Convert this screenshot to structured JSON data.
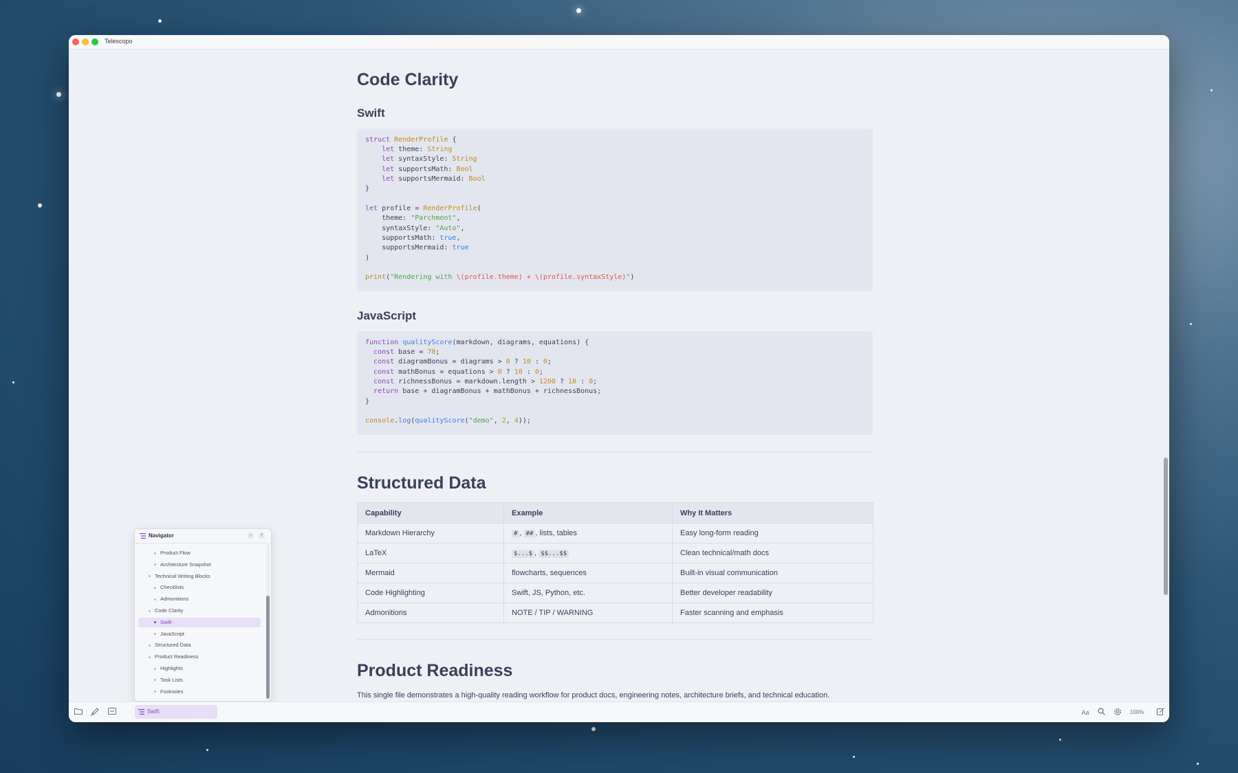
{
  "app": {
    "title": "Telescopo"
  },
  "article": {
    "h_code_clarity": "Code Clarity",
    "h_swift": "Swift",
    "swift_code": [
      "struct RenderProfile {",
      "    let theme: String",
      "    let syntaxStyle: String",
      "    let supportsMath: Bool",
      "    let supportsMermaid: Bool",
      "}",
      "",
      "let profile = RenderProfile(",
      "    theme: \"Parchment\",",
      "    syntaxStyle: \"Auto\",",
      "    supportsMath: true,",
      "    supportsMermaid: true",
      ")",
      "",
      "print(\"Rendering with \\(profile.theme) + \\(profile.syntaxStyle)\")"
    ],
    "h_javascript": "JavaScript",
    "js_code": [
      "function qualityScore(markdown, diagrams, equations) {",
      "  const base = 70;",
      "  const diagramBonus = diagrams > 0 ? 10 : 0;",
      "  const mathBonus = equations > 0 ? 10 : 0;",
      "  const richnessBonus = markdown.length > 1200 ? 10 : 0;",
      "  return base + diagramBonus + mathBonus + richnessBonus;",
      "}",
      "",
      "console.log(qualityScore(\"demo\", 2, 4));"
    ],
    "h_structured_data": "Structured Data",
    "table": {
      "headers": [
        "Capability",
        "Example",
        "Why It Matters"
      ],
      "rows": [
        {
          "capability": "Markdown Hierarchy",
          "example_codes": [
            "#",
            "##"
          ],
          "example_text": ", lists, tables",
          "why": "Easy long-form reading"
        },
        {
          "capability": "LaTeX",
          "example_codes": [
            "$...$",
            "$$...$$"
          ],
          "example_text": "",
          "why": "Clean technical/math docs"
        },
        {
          "capability": "Mermaid",
          "example_codes": [],
          "example_text": "flowcharts, sequences",
          "why": "Built-in visual communication"
        },
        {
          "capability": "Code Highlighting",
          "example_codes": [],
          "example_text": "Swift, JS, Python, etc.",
          "why": "Better developer readability"
        },
        {
          "capability": "Admonitions",
          "example_codes": [],
          "example_text": "NOTE / TIP / WARNING",
          "why": "Faster scanning and emphasis"
        }
      ]
    },
    "h_product_readiness": "Product Readiness",
    "product_readiness_text": "This single file demonstrates a high-quality reading workflow for product docs, engineering notes, architecture briefs, and technical education."
  },
  "navigator": {
    "title": "Navigator",
    "items": [
      {
        "label": "Product Flow",
        "level": 2,
        "active": false
      },
      {
        "label": "Architecture Snapshot",
        "level": 2,
        "active": false
      },
      {
        "label": "Technical Writing Blocks",
        "level": 1,
        "active": false
      },
      {
        "label": "Checklists",
        "level": 2,
        "active": false
      },
      {
        "label": "Admonitions",
        "level": 2,
        "active": false
      },
      {
        "label": "Code Clarity",
        "level": 1,
        "active": false
      },
      {
        "label": "Swift",
        "level": 2,
        "active": true
      },
      {
        "label": "JavaScript",
        "level": 2,
        "active": false
      },
      {
        "label": "Structured Data",
        "level": 1,
        "active": false
      },
      {
        "label": "Product Readiness",
        "level": 1,
        "active": false
      },
      {
        "label": "Highlights",
        "level": 2,
        "active": false
      },
      {
        "label": "Task Lists",
        "level": 2,
        "active": false
      },
      {
        "label": "Footnotes",
        "level": 2,
        "active": false
      }
    ]
  },
  "footer": {
    "breadcrumb": "Swift",
    "font_label": "Aa",
    "zoom": "100%"
  },
  "icons": {
    "folder": "folder-icon",
    "brush": "brush-icon",
    "layout": "layout-icon",
    "search": "search-icon",
    "settings": "gear-icon",
    "edit": "edit-icon"
  },
  "colors": {
    "accent": "#8744c8",
    "keyword": "#8b47b8",
    "type": "#c08a1e",
    "string": "#4ea24e",
    "boolean": "#2e7fd6",
    "interpolation": "#e0514a"
  }
}
